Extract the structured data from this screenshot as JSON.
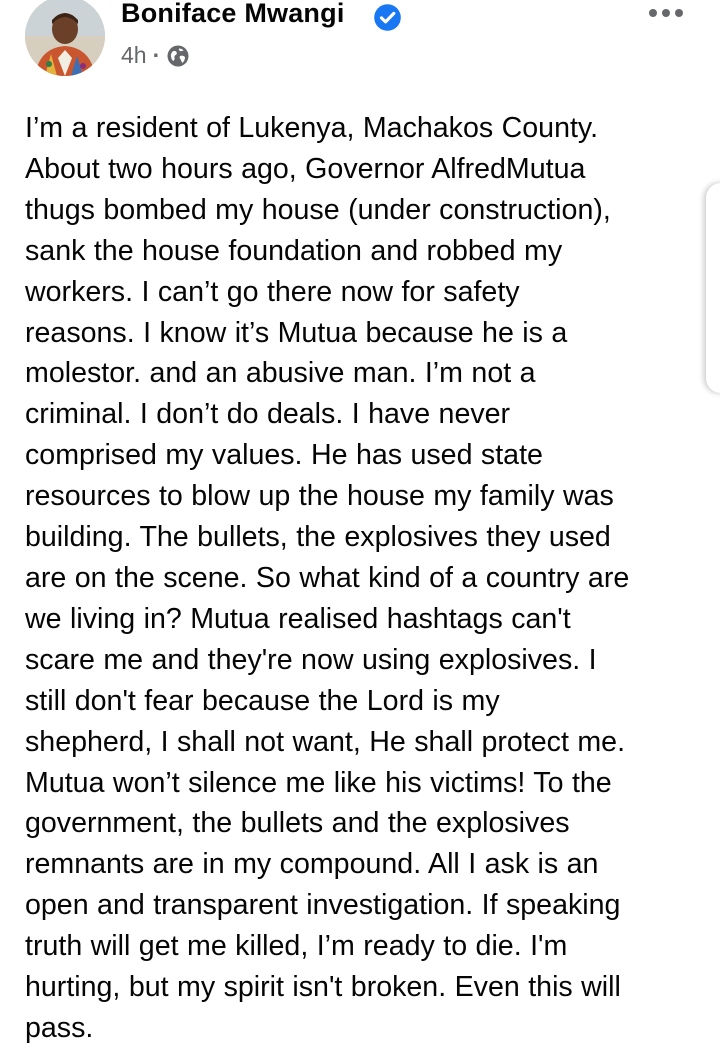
{
  "post": {
    "author": {
      "name": "Boniface Mwangi",
      "verified": true,
      "avatar_icon": "profile-photo"
    },
    "meta": {
      "time": "4h",
      "separator": "·",
      "audience_icon": "globe-icon"
    },
    "menu_icon": "more-horizontal-icon",
    "body_lines": [
      "I’m a resident of Lukenya, Machakos County.",
      "About two hours ago, Governor AlfredMutua",
      "thugs bombed my house (under construction),",
      "sank the house foundation and robbed my",
      "workers. I can’t go there now for safety",
      "reasons. I know it’s Mutua because he is a",
      "molestor. and an abusive man. I’m not a",
      "criminal. I don’t do deals. I have never",
      "comprised my values. He has used state",
      "resources to blow up the house my family was",
      "building. The bullets, the explosives they used",
      "are on the scene. So what kind of a country are",
      "we living in? Mutua realised hashtags can't",
      "scare me and they're now using explosives. I",
      "still don't fear because the Lord is my",
      "shepherd, I shall not want, He shall protect me.",
      "Mutua won’t silence me like his victims! To the",
      "government, the bullets and the explosives",
      "remnants are in my compound. All I ask is an",
      "open and transparent investigation. If speaking",
      "truth will get me killed, I’m ready to die. I'm",
      "hurting, but my spirit isn't broken. Even this will",
      "pass."
    ]
  },
  "colors": {
    "text": "#050505",
    "secondary": "#65676b",
    "verified_blue": "#1877f2",
    "background": "#ffffff"
  }
}
